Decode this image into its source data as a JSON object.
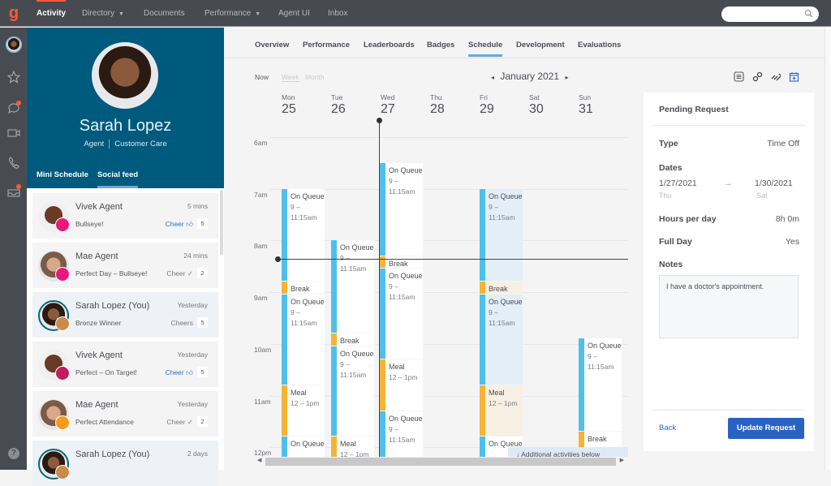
{
  "topbar": {
    "logo": "g",
    "nav": [
      {
        "label": "Activity",
        "active": true,
        "caret": false
      },
      {
        "label": "Directory",
        "active": false,
        "caret": true
      },
      {
        "label": "Documents",
        "active": false,
        "caret": false
      },
      {
        "label": "Performance",
        "active": false,
        "caret": true
      },
      {
        "label": "Agent UI",
        "active": false,
        "caret": false
      },
      {
        "label": "Inbox",
        "active": false,
        "caret": false
      }
    ],
    "search_placeholder": ""
  },
  "rail": {
    "icons": [
      "avatar",
      "star-icon",
      "chat-icon",
      "video-icon",
      "phone-icon",
      "inbox-icon",
      "help-icon"
    ],
    "help_label": "?"
  },
  "profile": {
    "name": "Sarah Lopez",
    "role": "Agent",
    "department": "Customer Care",
    "tabs": [
      {
        "label": "Mini Schedule",
        "active": false
      },
      {
        "label": "Social feed",
        "active": true
      }
    ]
  },
  "feed": [
    {
      "name": "Vivek Agent",
      "text": "Bullseye!",
      "time": "5 mins",
      "cheer": "Cheer",
      "cheer_icon": "thumbs-up",
      "count": "5",
      "badge_color": "#e8197a",
      "avatar": "man",
      "me": false
    },
    {
      "name": "Mae Agent",
      "text": "Perfect Day – Bullseye!",
      "time": "24 mins",
      "cheer": "Cheer",
      "cheer_icon": "check",
      "count": "2",
      "badge_color": "#e8197a",
      "avatar": "mae",
      "me": false
    },
    {
      "name": "Sarah Lopez (You)",
      "text": "Bronze Winner",
      "time": "Yesterday",
      "cheer": "Cheers",
      "cheer_icon": "",
      "count": "5",
      "badge_color": "#c98a4a",
      "avatar": "sarah",
      "me": true
    },
    {
      "name": "Vivek Agent",
      "text": "Perfect – On Target!",
      "time": "Yesterday",
      "cheer": "Cheer",
      "cheer_icon": "thumbs-up",
      "count": "5",
      "badge_color": "#c21c62",
      "avatar": "man",
      "me": false
    },
    {
      "name": "Mae Agent",
      "text": "Perfect Attendance",
      "time": "Yesterday",
      "cheer": "Cheer",
      "cheer_icon": "check",
      "count": "2",
      "badge_color": "#f59a1d",
      "avatar": "mae",
      "me": false
    },
    {
      "name": "Sarah Lopez (You)",
      "text": "",
      "time": "2 days",
      "cheer": "",
      "cheer_icon": "",
      "count": "",
      "badge_color": "#c98a4a",
      "avatar": "sarah",
      "me": true
    }
  ],
  "tabs": [
    {
      "label": "Overview",
      "active": false
    },
    {
      "label": "Performance",
      "active": false
    },
    {
      "label": "Leaderboards",
      "active": false
    },
    {
      "label": "Badges",
      "active": false
    },
    {
      "label": "Schedule",
      "active": true
    },
    {
      "label": "Development",
      "active": false
    },
    {
      "label": "Evaluations",
      "active": false
    }
  ],
  "schedule": {
    "now_label": "Now",
    "view_week": "Week",
    "view_month": "Month",
    "month": "January 2021",
    "prev": "◂",
    "next": "▸",
    "toolbar_icons": [
      "list-icon",
      "link-icon",
      "swap-icon",
      "calendar-add-icon"
    ],
    "days": [
      {
        "name": "Mon",
        "date": "25"
      },
      {
        "name": "Tue",
        "date": "26"
      },
      {
        "name": "Wed",
        "date": "27"
      },
      {
        "name": "Thu",
        "date": "28"
      },
      {
        "name": "Fri",
        "date": "29"
      },
      {
        "name": "Sat",
        "date": "30"
      },
      {
        "name": "Sun",
        "date": "31"
      }
    ],
    "hours": [
      "6am",
      "7am",
      "8am",
      "9am",
      "10am",
      "11am",
      "12pm"
    ],
    "events": [
      {
        "day": 0,
        "start": 7.0,
        "end": 8.8,
        "type": "q",
        "title": "On Queue",
        "sub": "9 – 11:15am"
      },
      {
        "day": 0,
        "start": 8.8,
        "end": 9.05,
        "type": "b",
        "title": "Break",
        "sub": ""
      },
      {
        "day": 0,
        "start": 9.05,
        "end": 10.8,
        "type": "q",
        "title": "On Queue",
        "sub": "9 – 11:15am"
      },
      {
        "day": 0,
        "start": 10.8,
        "end": 11.8,
        "type": "b",
        "title": "Meal",
        "sub": "12 – 1pm"
      },
      {
        "day": 0,
        "start": 11.8,
        "end": 12.5,
        "type": "q",
        "title": "On Queue",
        "sub": ""
      },
      {
        "day": 1,
        "start": 8.0,
        "end": 9.8,
        "type": "q",
        "title": "On Queue",
        "sub": "9 – 11:15am"
      },
      {
        "day": 1,
        "start": 9.8,
        "end": 10.05,
        "type": "b",
        "title": "Break",
        "sub": ""
      },
      {
        "day": 1,
        "start": 10.05,
        "end": 11.8,
        "type": "q",
        "title": "On Queue",
        "sub": "9 – 11:15am"
      },
      {
        "day": 1,
        "start": 11.8,
        "end": 12.5,
        "type": "b",
        "title": "Meal",
        "sub": "12 – 1pm"
      },
      {
        "day": 2,
        "start": 6.5,
        "end": 8.3,
        "type": "q",
        "title": "On Queue",
        "sub": "9 – 11:15am"
      },
      {
        "day": 2,
        "start": 8.3,
        "end": 8.55,
        "type": "b",
        "title": "Break",
        "sub": ""
      },
      {
        "day": 2,
        "start": 8.55,
        "end": 10.3,
        "type": "q",
        "title": "On Queue",
        "sub": "9 – 11:15am"
      },
      {
        "day": 2,
        "start": 10.3,
        "end": 11.3,
        "type": "b",
        "title": "Meal",
        "sub": "12 – 1pm"
      },
      {
        "day": 2,
        "start": 11.3,
        "end": 12.5,
        "type": "q",
        "title": "On Queue",
        "sub": "9 – 11:15am"
      },
      {
        "day": 4,
        "start": 7.0,
        "end": 8.8,
        "type": "q",
        "title": "On Queue",
        "sub": "9 – 11:15am",
        "sel": true
      },
      {
        "day": 4,
        "start": 8.8,
        "end": 9.05,
        "type": "b",
        "title": "Break",
        "sub": "",
        "sel": true
      },
      {
        "day": 4,
        "start": 9.05,
        "end": 10.8,
        "type": "q",
        "title": "On Queue",
        "sub": "9 – 11:15am",
        "sel": true
      },
      {
        "day": 4,
        "start": 10.8,
        "end": 11.8,
        "type": "b",
        "title": "Meal",
        "sub": "12 – 1pm",
        "sel": true
      },
      {
        "day": 4,
        "start": 11.8,
        "end": 12.5,
        "type": "q",
        "title": "On Queue",
        "sub": ""
      },
      {
        "day": 6,
        "start": 9.9,
        "end": 11.7,
        "type": "q",
        "title": "On Queue",
        "sub": "9 – 11:15am"
      },
      {
        "day": 6,
        "start": 11.7,
        "end": 12.5,
        "type": "b",
        "title": "Break",
        "sub": ""
      }
    ],
    "additional": "↓  Additional activities below"
  },
  "pending": {
    "title": "Pending Request",
    "type_label": "Type",
    "type_value": "Time Off",
    "dates_label": "Dates",
    "start_date": "1/27/2021",
    "start_day": "Thu",
    "arrow": "→",
    "end_date": "1/30/2021",
    "end_day": "Sat",
    "hours_label": "Hours per day",
    "hours_value": "8h 0m",
    "fullday_label": "Full Day",
    "fullday_value": "Yes",
    "notes_label": "Notes",
    "notes_value": "I have a doctor's appointment.",
    "back_label": "Back",
    "update_label": "Update Request"
  },
  "colors": {
    "accent": "#ff5b35",
    "queue": "#4fc0ea",
    "break": "#f6b334",
    "primary_button": "#2a62c4",
    "profile_bg": "#005a7d"
  }
}
